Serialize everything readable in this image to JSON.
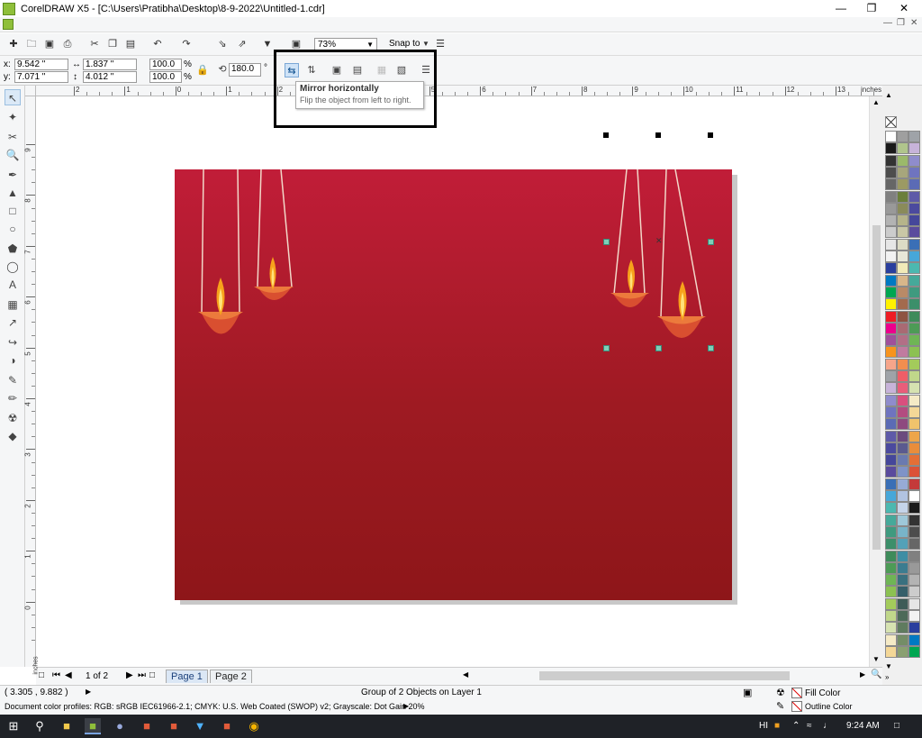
{
  "window": {
    "title": "CorelDRAW X5 - [C:\\Users\\Pratibha\\Desktop\\8-9-2022\\Untitled-1.cdr]",
    "minimize_icon": "minimize-icon",
    "maximize_icon": "maximize-icon",
    "close_icon": "close-icon"
  },
  "toolbar": {
    "zoom": "73%",
    "snap_to": "Snap to"
  },
  "properties": {
    "x_label": "x:",
    "x_value": "9.542 \"",
    "y_label": "y:",
    "y_value": "7.071 \"",
    "width_value": "1.837 \"",
    "height_value": "4.012 \"",
    "scale_w": "100.0",
    "scale_h": "100.0",
    "percent": "%",
    "angle": "180.0",
    "degree": "°"
  },
  "tooltip": {
    "title": "Mirror horizontally",
    "text": "Flip the object from left to right."
  },
  "ruler": {
    "unit": "inches",
    "h_labels": [
      "2",
      "1",
      "0",
      "1",
      "2",
      "3",
      "4",
      "5",
      "6",
      "7",
      "8",
      "9",
      "10",
      "11",
      "12",
      "13"
    ],
    "v_labels": [
      "9",
      "8",
      "7",
      "6",
      "5",
      "4",
      "3",
      "2",
      "1",
      "0"
    ]
  },
  "page_nav": {
    "counter": "1 of 2",
    "tabs": [
      "Page 1",
      "Page 2"
    ],
    "vertical_unit": "inches"
  },
  "status": {
    "coords": "( 3.305 , 9.882 )",
    "selection": "Group of 2 Objects on Layer 1",
    "profiles": "Document color profiles: RGB: sRGB IEC61966-2.1; CMYK: U.S. Web Coated (SWOP) v2; Grayscale: Dot Gain 20%",
    "fill_label": "Fill Color",
    "outline_label": "Outline Color"
  },
  "taskbar": {
    "lang": "HI",
    "time": "9:24 AM"
  },
  "colors": {
    "page_top": "#c11d38",
    "page_bottom": "#8e1619",
    "selection_accent": "#7ecfb8",
    "palette": [
      "#ffffff",
      "#1a1a1a",
      "#333333",
      "#4d4d4d",
      "#666666",
      "#808080",
      "#999999",
      "#b3b3b3",
      "#cccccc",
      "#e6e6e6",
      "#f2f2f2",
      "#2a3f9e",
      "#0079c2",
      "#00a651",
      "#fff200",
      "#ed1c24",
      "#ec008c",
      "#a0509b",
      "#f7941d",
      "#f6a58a",
      "#9fa3a8",
      "#c7b3d9",
      "#8f8ccc",
      "#6f74bf",
      "#5b6bb5",
      "#5e5aa8",
      "#4b4a9e",
      "#45479a",
      "#5a4b9d",
      "#3a6fb6",
      "#47a7d9",
      "#4cb8b0",
      "#46a99a",
      "#3f9a7f",
      "#3c8f6a",
      "#3e8b5a",
      "#4d9b56",
      "#6fb555",
      "#8cc152",
      "#a3cb5b",
      "#c0d78a",
      "#d6e2b1",
      "#f5eac6",
      "#f4d797",
      "#f0c36c",
      "#eda54a",
      "#e98d3b",
      "#e46f36",
      "#db5237",
      "#c43a3a"
    ],
    "palette2": [
      "#9f9f9f",
      "#b0c58c",
      "#9bb96a",
      "#a7a67c",
      "#9c9a63",
      "#6b7f3a",
      "#8a8b5a",
      "#b6b48a",
      "#c9c7a6",
      "#dcdbc5",
      "#e8e7d8",
      "#f1eab8",
      "#d8b68a",
      "#b98a67",
      "#a36a4d",
      "#8e5343",
      "#a96a73",
      "#b26f86",
      "#c07b9f",
      "#f28e4f",
      "#ef5d67",
      "#e95d7a",
      "#d94f7e",
      "#b34c80",
      "#8e4a7f",
      "#6b4a7e",
      "#5a5a8f",
      "#6a7ab0",
      "#7f93c7",
      "#97abd6",
      "#b1c3e1",
      "#c5d4e9",
      "#9ec8d9",
      "#78b4c9",
      "#53a1b8",
      "#3f8ea4",
      "#3b7c90",
      "#39707f",
      "#365f6a",
      "#3e5b57",
      "#4d6a58",
      "#5f7b5f",
      "#748d67",
      "#8aa071",
      "#a1b47e",
      "#b5c68e",
      "#c7d5a0",
      "#d7e2b4",
      "#e4ecc7",
      "#eef3d9"
    ]
  }
}
